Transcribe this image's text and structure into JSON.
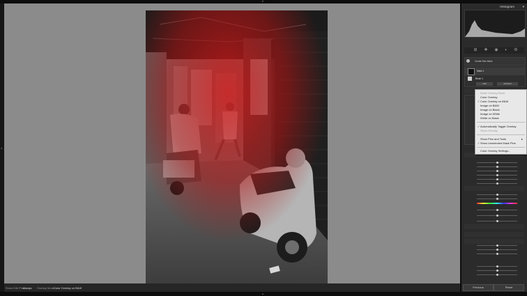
{
  "panel": {
    "title": "Histogram"
  },
  "statusbar": {
    "show_edit_pins_label": "Show Edit Pins :",
    "show_edit_pins_value": "Always",
    "overlay_mode_label": "Overlay Mode :",
    "overlay_mode_value": "Color Overlay on B&W"
  },
  "mask": {
    "create_new_mask": "Create New Mask",
    "mask_1": "Mask 1",
    "brush_1": "Brush 1",
    "add_label": "Add",
    "subtract_label": "Subtract"
  },
  "overlay_menu": {
    "header": "Mask Overlay Mode",
    "items": [
      {
        "label": "Color Overlay",
        "checked": false,
        "disabled": false
      },
      {
        "label": "Color Overlay on B&W",
        "checked": true,
        "disabled": false
      },
      {
        "label": "Image on B&W",
        "checked": false,
        "disabled": false
      },
      {
        "label": "Image on Black",
        "checked": false,
        "disabled": false
      },
      {
        "label": "Image on White",
        "checked": false,
        "disabled": false
      },
      {
        "label": "White on Black",
        "checked": false,
        "disabled": false
      }
    ],
    "toggle_items": [
      {
        "label": "Automatically Toggle Overlay",
        "checked": true,
        "disabled": false
      },
      {
        "label": "Show Overlay",
        "checked": false,
        "disabled": true
      }
    ],
    "pin_items": [
      {
        "label": "Show Pins and Tools",
        "checked": false,
        "disabled": false,
        "submenu": true
      },
      {
        "label": "Show Unselected Mask Pins",
        "checked": true,
        "disabled": false,
        "submenu": false
      }
    ],
    "settings_label": "Color Overlay Settings..."
  },
  "buttons": {
    "previous": "Previous",
    "reset": "Reset"
  },
  "colors": {
    "canvas": "#8b8b8b",
    "panel": "#2b2b2b",
    "mask_red": "#d11a1a",
    "menu_bg": "#e8e8e8"
  },
  "icons": [
    "histogram-icon",
    "crop-icon",
    "heal-icon",
    "red-eye-icon",
    "mask-icon",
    "settings-icon",
    "brush-icon",
    "menu-check-icon",
    "submenu-arrow-icon"
  ]
}
